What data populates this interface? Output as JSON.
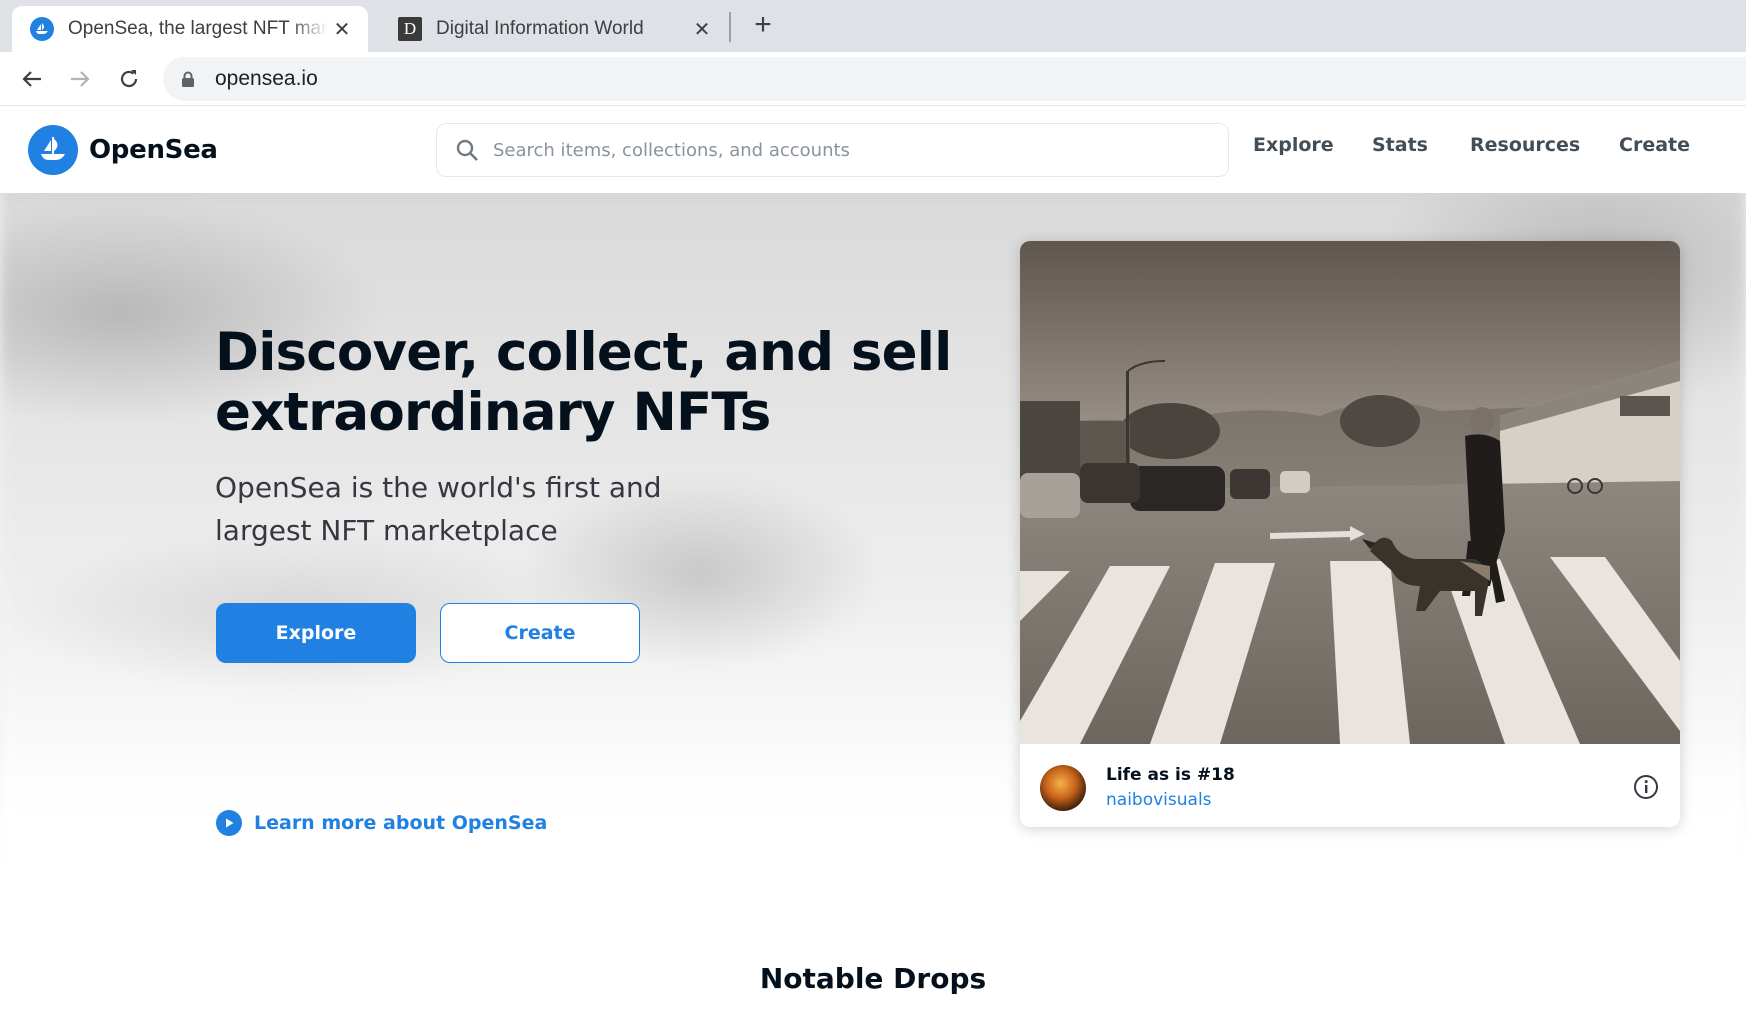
{
  "browser": {
    "tabs": [
      {
        "title": "OpenSea, the largest NFT market",
        "active": true,
        "favicon": "opensea-favicon"
      },
      {
        "title": "Digital Information World",
        "active": false,
        "favicon": "D"
      }
    ],
    "new_tab_symbol": "+",
    "close_symbol": "✕",
    "address": "opensea.io"
  },
  "header": {
    "brand": "OpenSea",
    "search_placeholder": "Search items, collections, and accounts",
    "nav": [
      "Explore",
      "Stats",
      "Resources",
      "Create"
    ]
  },
  "hero": {
    "title": "Discover, collect, and sell extraordinary NFTs",
    "subtitle": "OpenSea is the world's first and largest NFT marketplace",
    "explore_label": "Explore",
    "create_label": "Create",
    "learn_more": "Learn more about OpenSea"
  },
  "featured": {
    "name": "Life as is #18",
    "creator": "naibovisuals",
    "image_description_icon": "photo-street-crosswalk-dog"
  },
  "sections": {
    "notable_drops": "Notable Drops"
  },
  "colors": {
    "brand_blue": "#2081e2",
    "text_dark": "#04111d",
    "chrome_bg": "#dee1e6"
  }
}
